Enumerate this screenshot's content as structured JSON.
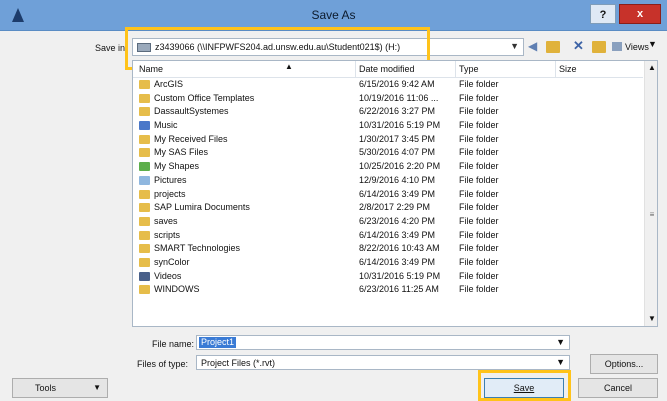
{
  "window": {
    "title": "Save As",
    "help_label": "?",
    "close_label": "x"
  },
  "save_in": {
    "label": "Save in:",
    "value": "z3439066 (\\\\INFPWFS204.ad.unsw.edu.au\\Student021$) (H:)"
  },
  "toolbar": {
    "views_label": "Views"
  },
  "columns": {
    "name": "Name",
    "date": "Date modified",
    "type": "Type",
    "size": "Size"
  },
  "files": [
    {
      "name": "ArcGIS",
      "date": "6/15/2016 9:42 AM",
      "type": "File folder",
      "icon": "folder-icon"
    },
    {
      "name": "Custom Office Templates",
      "date": "10/19/2016 11:06 ...",
      "type": "File folder",
      "icon": "folder-icon"
    },
    {
      "name": "DassaultSystemes",
      "date": "6/22/2016 3:27 PM",
      "type": "File folder",
      "icon": "folder-icon"
    },
    {
      "name": "Music",
      "date": "10/31/2016 5:19 PM",
      "type": "File folder",
      "icon": "music-folder-icon"
    },
    {
      "name": "My Received Files",
      "date": "1/30/2017 3:45 PM",
      "type": "File folder",
      "icon": "folder-icon"
    },
    {
      "name": "My SAS Files",
      "date": "5/30/2016 4:07 PM",
      "type": "File folder",
      "icon": "folder-icon"
    },
    {
      "name": "My Shapes",
      "date": "10/25/2016 2:20 PM",
      "type": "File folder",
      "icon": "shapes-folder-icon"
    },
    {
      "name": "Pictures",
      "date": "12/9/2016 4:10 PM",
      "type": "File folder",
      "icon": "pictures-folder-icon"
    },
    {
      "name": "projects",
      "date": "6/14/2016 3:49 PM",
      "type": "File folder",
      "icon": "folder-icon"
    },
    {
      "name": "SAP Lumira Documents",
      "date": "2/8/2017 2:29 PM",
      "type": "File folder",
      "icon": "folder-icon"
    },
    {
      "name": "saves",
      "date": "6/23/2016 4:20 PM",
      "type": "File folder",
      "icon": "folder-icon"
    },
    {
      "name": "scripts",
      "date": "6/14/2016 3:49 PM",
      "type": "File folder",
      "icon": "folder-icon"
    },
    {
      "name": "SMART Technologies",
      "date": "8/22/2016 10:43 AM",
      "type": "File folder",
      "icon": "folder-icon"
    },
    {
      "name": "synColor",
      "date": "6/14/2016 3:49 PM",
      "type": "File folder",
      "icon": "folder-icon"
    },
    {
      "name": "Videos",
      "date": "10/31/2016 5:19 PM",
      "type": "File folder",
      "icon": "videos-folder-icon"
    },
    {
      "name": "WINDOWS",
      "date": "6/23/2016 11:25 AM",
      "type": "File folder",
      "icon": "folder-icon"
    }
  ],
  "file_name": {
    "label": "File name:",
    "value": "Project1"
  },
  "file_type": {
    "label": "Files of type:",
    "value": "Project Files  (*.rvt)"
  },
  "buttons": {
    "options": "Options...",
    "save": "Save",
    "cancel": "Cancel",
    "tools": "Tools"
  },
  "colors": {
    "titlebar": "#6fa0d8",
    "close": "#c7322a",
    "highlight": "#ffc31a",
    "selection": "#3a7bd5"
  }
}
